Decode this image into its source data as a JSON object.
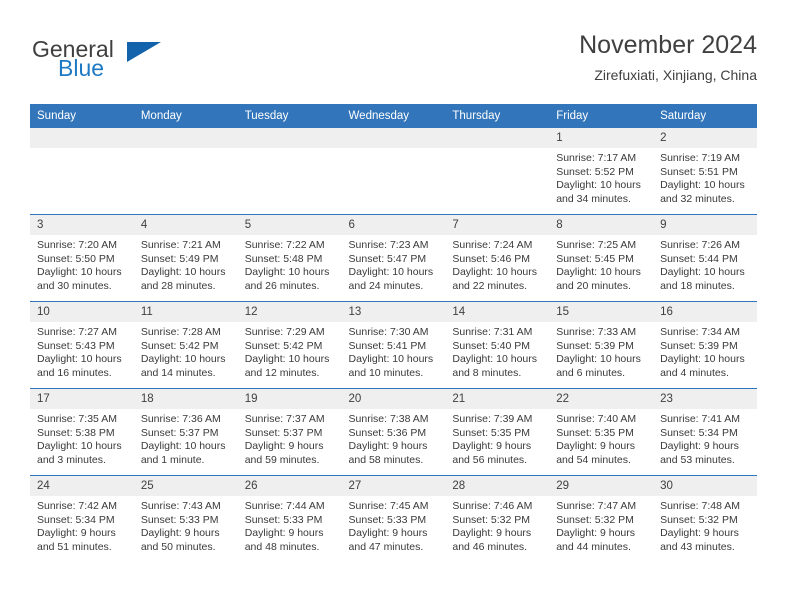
{
  "branding": {
    "name_part1": "General",
    "name_part2": "Blue",
    "triangle_color": "#1263ab",
    "blue_color": "#1f7ac4"
  },
  "header": {
    "title": "November 2024",
    "subtitle": "Zirefuxiati, Xinjiang, China"
  },
  "theme": {
    "header_bg": "#3275ba",
    "daynum_bg": "#efeff0",
    "text": "#404040"
  },
  "weekdays": [
    "Sunday",
    "Monday",
    "Tuesday",
    "Wednesday",
    "Thursday",
    "Friday",
    "Saturday"
  ],
  "labels": {
    "sunrise": "Sunrise:",
    "sunset": "Sunset:",
    "daylight": "Daylight:"
  },
  "weeks": [
    [
      {
        "day": "",
        "empty": true
      },
      {
        "day": "",
        "empty": true
      },
      {
        "day": "",
        "empty": true
      },
      {
        "day": "",
        "empty": true
      },
      {
        "day": "",
        "empty": true
      },
      {
        "day": "1",
        "sunrise": "Sunrise: 7:17 AM",
        "sunset": "Sunset: 5:52 PM",
        "daylight": "Daylight: 10 hours and 34 minutes."
      },
      {
        "day": "2",
        "sunrise": "Sunrise: 7:19 AM",
        "sunset": "Sunset: 5:51 PM",
        "daylight": "Daylight: 10 hours and 32 minutes."
      }
    ],
    [
      {
        "day": "3",
        "sunrise": "Sunrise: 7:20 AM",
        "sunset": "Sunset: 5:50 PM",
        "daylight": "Daylight: 10 hours and 30 minutes."
      },
      {
        "day": "4",
        "sunrise": "Sunrise: 7:21 AM",
        "sunset": "Sunset: 5:49 PM",
        "daylight": "Daylight: 10 hours and 28 minutes."
      },
      {
        "day": "5",
        "sunrise": "Sunrise: 7:22 AM",
        "sunset": "Sunset: 5:48 PM",
        "daylight": "Daylight: 10 hours and 26 minutes."
      },
      {
        "day": "6",
        "sunrise": "Sunrise: 7:23 AM",
        "sunset": "Sunset: 5:47 PM",
        "daylight": "Daylight: 10 hours and 24 minutes."
      },
      {
        "day": "7",
        "sunrise": "Sunrise: 7:24 AM",
        "sunset": "Sunset: 5:46 PM",
        "daylight": "Daylight: 10 hours and 22 minutes."
      },
      {
        "day": "8",
        "sunrise": "Sunrise: 7:25 AM",
        "sunset": "Sunset: 5:45 PM",
        "daylight": "Daylight: 10 hours and 20 minutes."
      },
      {
        "day": "9",
        "sunrise": "Sunrise: 7:26 AM",
        "sunset": "Sunset: 5:44 PM",
        "daylight": "Daylight: 10 hours and 18 minutes."
      }
    ],
    [
      {
        "day": "10",
        "sunrise": "Sunrise: 7:27 AM",
        "sunset": "Sunset: 5:43 PM",
        "daylight": "Daylight: 10 hours and 16 minutes."
      },
      {
        "day": "11",
        "sunrise": "Sunrise: 7:28 AM",
        "sunset": "Sunset: 5:42 PM",
        "daylight": "Daylight: 10 hours and 14 minutes."
      },
      {
        "day": "12",
        "sunrise": "Sunrise: 7:29 AM",
        "sunset": "Sunset: 5:42 PM",
        "daylight": "Daylight: 10 hours and 12 minutes."
      },
      {
        "day": "13",
        "sunrise": "Sunrise: 7:30 AM",
        "sunset": "Sunset: 5:41 PM",
        "daylight": "Daylight: 10 hours and 10 minutes."
      },
      {
        "day": "14",
        "sunrise": "Sunrise: 7:31 AM",
        "sunset": "Sunset: 5:40 PM",
        "daylight": "Daylight: 10 hours and 8 minutes."
      },
      {
        "day": "15",
        "sunrise": "Sunrise: 7:33 AM",
        "sunset": "Sunset: 5:39 PM",
        "daylight": "Daylight: 10 hours and 6 minutes."
      },
      {
        "day": "16",
        "sunrise": "Sunrise: 7:34 AM",
        "sunset": "Sunset: 5:39 PM",
        "daylight": "Daylight: 10 hours and 4 minutes."
      }
    ],
    [
      {
        "day": "17",
        "sunrise": "Sunrise: 7:35 AM",
        "sunset": "Sunset: 5:38 PM",
        "daylight": "Daylight: 10 hours and 3 minutes."
      },
      {
        "day": "18",
        "sunrise": "Sunrise: 7:36 AM",
        "sunset": "Sunset: 5:37 PM",
        "daylight": "Daylight: 10 hours and 1 minute."
      },
      {
        "day": "19",
        "sunrise": "Sunrise: 7:37 AM",
        "sunset": "Sunset: 5:37 PM",
        "daylight": "Daylight: 9 hours and 59 minutes."
      },
      {
        "day": "20",
        "sunrise": "Sunrise: 7:38 AM",
        "sunset": "Sunset: 5:36 PM",
        "daylight": "Daylight: 9 hours and 58 minutes."
      },
      {
        "day": "21",
        "sunrise": "Sunrise: 7:39 AM",
        "sunset": "Sunset: 5:35 PM",
        "daylight": "Daylight: 9 hours and 56 minutes."
      },
      {
        "day": "22",
        "sunrise": "Sunrise: 7:40 AM",
        "sunset": "Sunset: 5:35 PM",
        "daylight": "Daylight: 9 hours and 54 minutes."
      },
      {
        "day": "23",
        "sunrise": "Sunrise: 7:41 AM",
        "sunset": "Sunset: 5:34 PM",
        "daylight": "Daylight: 9 hours and 53 minutes."
      }
    ],
    [
      {
        "day": "24",
        "sunrise": "Sunrise: 7:42 AM",
        "sunset": "Sunset: 5:34 PM",
        "daylight": "Daylight: 9 hours and 51 minutes."
      },
      {
        "day": "25",
        "sunrise": "Sunrise: 7:43 AM",
        "sunset": "Sunset: 5:33 PM",
        "daylight": "Daylight: 9 hours and 50 minutes."
      },
      {
        "day": "26",
        "sunrise": "Sunrise: 7:44 AM",
        "sunset": "Sunset: 5:33 PM",
        "daylight": "Daylight: 9 hours and 48 minutes."
      },
      {
        "day": "27",
        "sunrise": "Sunrise: 7:45 AM",
        "sunset": "Sunset: 5:33 PM",
        "daylight": "Daylight: 9 hours and 47 minutes."
      },
      {
        "day": "28",
        "sunrise": "Sunrise: 7:46 AM",
        "sunset": "Sunset: 5:32 PM",
        "daylight": "Daylight: 9 hours and 46 minutes."
      },
      {
        "day": "29",
        "sunrise": "Sunrise: 7:47 AM",
        "sunset": "Sunset: 5:32 PM",
        "daylight": "Daylight: 9 hours and 44 minutes."
      },
      {
        "day": "30",
        "sunrise": "Sunrise: 7:48 AM",
        "sunset": "Sunset: 5:32 PM",
        "daylight": "Daylight: 9 hours and 43 minutes."
      }
    ]
  ]
}
